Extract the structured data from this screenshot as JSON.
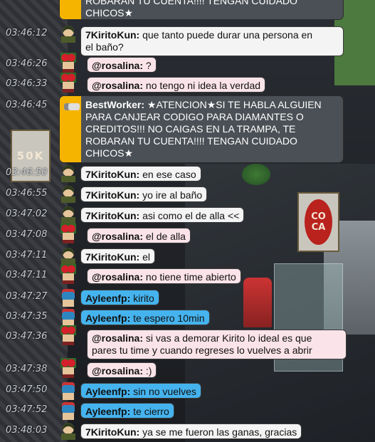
{
  "top_fragment": {
    "text": "ROBARAN TU CUENTA!!!! TENGAN CUIDADO",
    "text2": "CHICOS★"
  },
  "rooms": {
    "banner_50k": "50K",
    "banner_coca_1": "CO",
    "banner_coca_2": "CA"
  },
  "messages": [
    {
      "time": "03:46:12",
      "user": "7KiritoKun:",
      "text": "que tanto puede durar una persona en",
      "text2": "el baño?",
      "style": "white",
      "avatar": "kirito"
    },
    {
      "time": "03:46:26",
      "user": "@rosalina:",
      "text": "?",
      "style": "pink",
      "avatar": "rosa"
    },
    {
      "time": "03:46:33",
      "user": "@rosalina:",
      "text": "no tengo ni idea la verdad",
      "style": "pink",
      "avatar": "rosa"
    },
    {
      "time": "03:46:45",
      "user": "BestWorker:",
      "text": "★ATENCION★SI TE HABLA ALGUIEN",
      "line2": "PARA CANJEAR CODIGO PARA DIAMANTES O",
      "line3": "CREDITOS!!! NO CAIGAS EN LA TRAMPA, TE",
      "line4": "ROBARAN TU CUENTA!!!! TENGAN CUIDADO",
      "line5": "CHICOS★",
      "style": "system",
      "avatar": "robot"
    },
    {
      "time": "03:46:50",
      "user": "7KiritoKun:",
      "text": "en ese caso",
      "style": "white",
      "avatar": "kirito"
    },
    {
      "time": "03:46:55",
      "user": "7KiritoKun:",
      "text": "yo ire al baño",
      "style": "white",
      "avatar": "kirito"
    },
    {
      "time": "03:47:02",
      "user": "7KiritoKun:",
      "text": "asi como el de alla <<",
      "style": "white",
      "avatar": "kirito"
    },
    {
      "time": "03:47:08",
      "user": "@rosalina:",
      "text": "el de alla",
      "style": "pink",
      "avatar": "rosa"
    },
    {
      "time": "03:47:11",
      "user": "7KiritoKun:",
      "text": "el",
      "style": "white",
      "avatar": "kirito"
    },
    {
      "time": "03:47:11",
      "user": "@rosalina:",
      "text": "no tiene time abierto",
      "style": "pink",
      "avatar": "rosa"
    },
    {
      "time": "03:47:27",
      "user": "Ayleenfp:",
      "text": "kirito",
      "style": "blue",
      "avatar": "aylee"
    },
    {
      "time": "03:47:35",
      "user": "Ayleenfp:",
      "text": "te espero 10min",
      "style": "blue",
      "avatar": "aylee"
    },
    {
      "time": "03:47:36",
      "user": "@rosalina:",
      "text": "si vas a demorar Kirito lo ideal es que",
      "text2": "pares tu time y cuando regreses lo vuelves a abrir",
      "style": "pink",
      "avatar": "rosa"
    },
    {
      "time": "03:47:38",
      "user": "@rosalina:",
      "text": ":)",
      "style": "pink",
      "avatar": "rosa"
    },
    {
      "time": "03:47:50",
      "user": "Ayleenfp:",
      "text": "sin no vuelves",
      "style": "blue",
      "avatar": "aylee"
    },
    {
      "time": "03:47:52",
      "user": "Ayleenfp:",
      "text": "te cierro",
      "style": "blue",
      "avatar": "aylee"
    },
    {
      "time": "03:48:03",
      "user": "7KiritoKun:",
      "text": "ya se me fueron las ganas, gracias",
      "style": "white",
      "avatar": "kirito"
    }
  ],
  "colors": {
    "pink": "#fbe4e9",
    "white": "#f4f4f4",
    "blue": "#45b3ee",
    "system": "#4b5056",
    "accent": "#f4b400"
  }
}
